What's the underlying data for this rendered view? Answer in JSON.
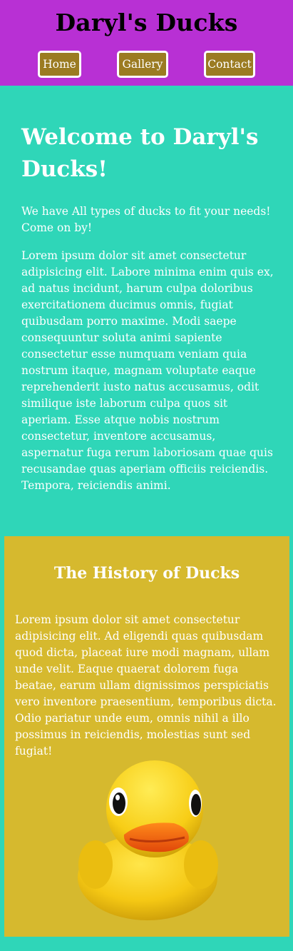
{
  "header": {
    "title": "Daryl's Ducks",
    "nav": [
      {
        "label": "Home"
      },
      {
        "label": "Gallery"
      },
      {
        "label": "Contact"
      }
    ]
  },
  "welcome": {
    "heading": "Welcome to Daryl's Ducks!",
    "intro": "We have All types of ducks to fit your needs! Come on by!",
    "body": "Lorem ipsum dolor sit amet consectetur adipisicing elit. Labore minima enim quis ex, ad natus incidunt, harum culpa doloribus exercitationem ducimus omnis, fugiat quibusdam porro maxime. Modi saepe consequuntur soluta animi sapiente consectetur esse numquam veniam quia nostrum itaque, magnam voluptate eaque reprehenderit iusto natus accusamus, odit similique iste laborum culpa quos sit aperiam. Esse atque nobis nostrum consectetur, inventore accusamus, aspernatur fuga rerum laboriosam quae quis recusandae quas aperiam officiis reiciendis. Tempora, reiciendis animi."
  },
  "history": {
    "heading": "The History of Ducks",
    "body": "Lorem ipsum dolor sit amet consectetur adipisicing elit. Ad eligendi quas quibusdam quod dicta, placeat iure modi magnam, ullam unde velit. Eaque quaerat dolorem fuga beatae, earum ullam dignissimos perspiciatis vero inventore praesentium, temporibus dicta. Odio pariatur unde eum, omnis nihil a illo possimus in reiciendis, molestias sunt sed fugiat!",
    "image": "rubber-duck"
  },
  "colors": {
    "header_bg": "#b830d4",
    "page_bg": "#2fd6b8",
    "history_bg": "#d6b92e",
    "nav_button_bg": "#9b7b22"
  }
}
